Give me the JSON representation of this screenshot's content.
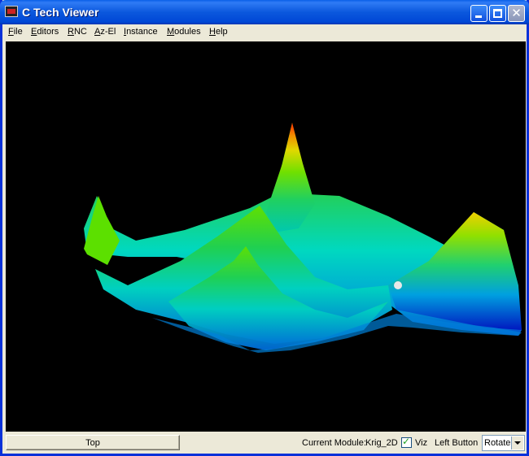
{
  "window": {
    "title": "C Tech Viewer"
  },
  "menu": [
    "File",
    "Editors",
    "RNC",
    "Az-El",
    "Instance",
    "Modules",
    "Help"
  ],
  "viewport": {
    "background": "#000000",
    "surface_colors": [
      "#ff2a00",
      "#f0d000",
      "#5ce000",
      "#00e0c8",
      "#0060e0",
      "#0010c0"
    ]
  },
  "status": {
    "top_button": "Top",
    "current_module_label": "Current Module:",
    "current_module_value": "Krig_2D",
    "viz_label": "Viz",
    "viz_checked": true,
    "left_button_label": "Left Button",
    "left_button_value": "Rotate"
  }
}
